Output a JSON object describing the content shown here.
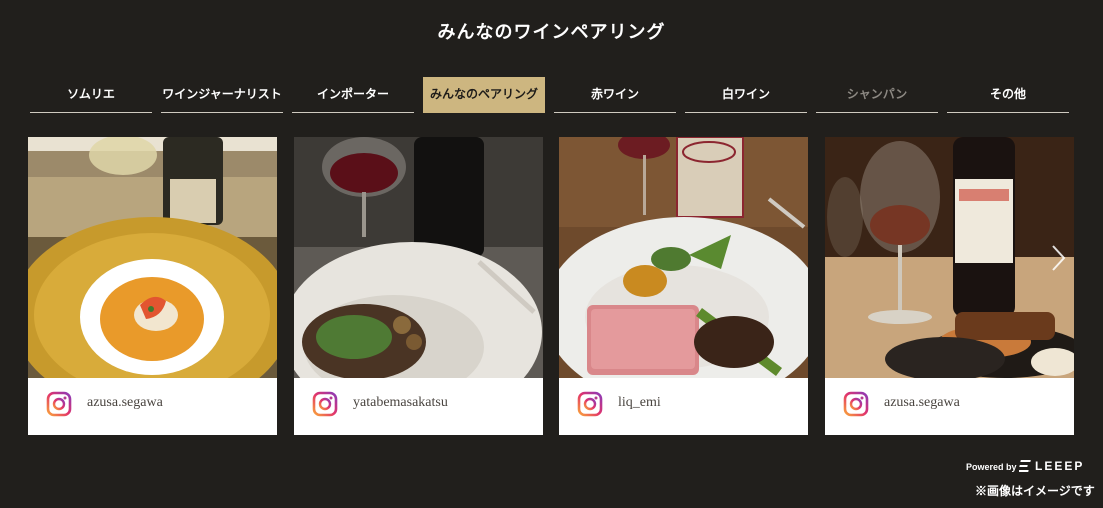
{
  "section": {
    "title": "みんなのワインペアリング"
  },
  "tabs": [
    {
      "label": "ソムリエ",
      "state": "normal"
    },
    {
      "label": "ワインジャーナリスト",
      "state": "normal"
    },
    {
      "label": "インポーター",
      "state": "normal"
    },
    {
      "label": "みんなのペアリング",
      "state": "active"
    },
    {
      "label": "赤ワイン",
      "state": "normal"
    },
    {
      "label": "白ワイン",
      "state": "normal"
    },
    {
      "label": "シャンパン",
      "state": "dim"
    },
    {
      "label": "その他",
      "state": "normal"
    }
  ],
  "cards": [
    {
      "username": "azusa.segawa",
      "icon": "instagram-icon"
    },
    {
      "username": "yatabemasakatsu",
      "icon": "instagram-icon"
    },
    {
      "username": "liq_emi",
      "icon": "instagram-icon"
    },
    {
      "username": "azusa.segawa",
      "icon": "instagram-icon"
    }
  ],
  "footer": {
    "powered_by": "Powered by",
    "brand": "LEEEP",
    "note": "※画像はイメージです"
  },
  "colors": {
    "background": "#211f1c",
    "active_tab": "#cdb680",
    "tab_text": "#ffffff",
    "tab_dim_text": "#8d8983"
  }
}
